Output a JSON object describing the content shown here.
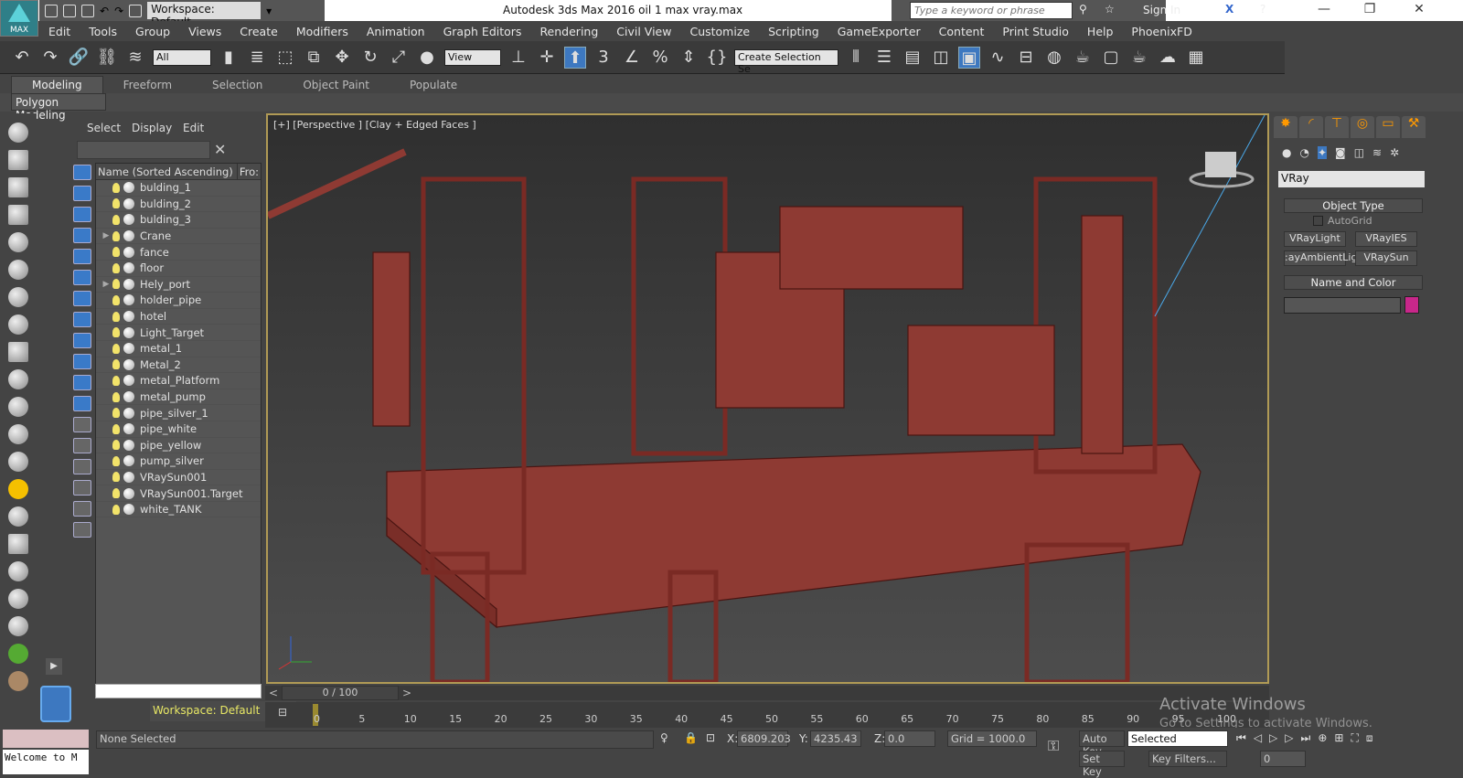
{
  "app": {
    "title": "Autodesk 3ds Max 2016    oil 1 max vray.max",
    "logo_text": "MAX",
    "workspace": "Workspace: Default"
  },
  "search": {
    "placeholder": "Type a keyword or phrase",
    "sign_in": "Sign In"
  },
  "menu": [
    "Edit",
    "Tools",
    "Group",
    "Views",
    "Create",
    "Modifiers",
    "Animation",
    "Graph Editors",
    "Rendering",
    "Civil View",
    "Customize",
    "Scripting",
    "GameExporter",
    "Content",
    "Print Studio",
    "Help",
    "PhoenixFD"
  ],
  "toolbar": {
    "filter": "All",
    "ref_coord": "View",
    "selection_set": "Create Selection Se",
    "snap_label": "3"
  },
  "ribbon": {
    "tabs": [
      "Modeling",
      "Freeform",
      "Selection",
      "Object Paint",
      "Populate"
    ],
    "active": "Modeling",
    "panel": "Polygon Modeling"
  },
  "explorer": {
    "tabs": [
      "Select",
      "Display",
      "Edit"
    ],
    "col_name": "Name (Sorted Ascending)",
    "col_frozen": "Fro:",
    "items": [
      {
        "name": "bulding_1",
        "type": "geometry",
        "expandable": false
      },
      {
        "name": "bulding_2",
        "type": "geometry",
        "expandable": false
      },
      {
        "name": "bulding_3",
        "type": "geometry",
        "expandable": false
      },
      {
        "name": "Crane",
        "type": "group",
        "expandable": true
      },
      {
        "name": "fance",
        "type": "geometry",
        "expandable": false
      },
      {
        "name": "floor",
        "type": "geometry",
        "expandable": false
      },
      {
        "name": "Hely_port",
        "type": "group",
        "expandable": true
      },
      {
        "name": "holder_pipe",
        "type": "geometry",
        "expandable": false
      },
      {
        "name": "hotel",
        "type": "geometry",
        "expandable": false
      },
      {
        "name": "Light_Target",
        "type": "group",
        "expandable": false
      },
      {
        "name": "metal_1",
        "type": "geometry",
        "expandable": false
      },
      {
        "name": "Metal_2",
        "type": "geometry",
        "expandable": false
      },
      {
        "name": "metal_Platform",
        "type": "geometry",
        "expandable": false
      },
      {
        "name": "metal_pump",
        "type": "geometry",
        "expandable": false
      },
      {
        "name": "pipe_silver_1",
        "type": "geometry",
        "expandable": false
      },
      {
        "name": "pipe_white",
        "type": "geometry",
        "expandable": false
      },
      {
        "name": "pipe_yellow",
        "type": "geometry",
        "expandable": false
      },
      {
        "name": "pump_silver",
        "type": "geometry",
        "expandable": false
      },
      {
        "name": "VRaySun001",
        "type": "light",
        "expandable": false
      },
      {
        "name": "VRaySun001.Target",
        "type": "light",
        "expandable": false
      },
      {
        "name": "white_TANK",
        "type": "geometry",
        "expandable": false
      }
    ],
    "workspace": "Workspace: Default"
  },
  "viewport": {
    "label": "[+] [Perspective ] [Clay + Edged Faces ]",
    "model_color": "#8e3a33"
  },
  "command_panel": {
    "category": "VRay",
    "object_type": "Object Type",
    "autogrid": "AutoGrid",
    "buttons": [
      "VRayLight",
      "VRayIES",
      "VRayAmbientLight",
      "VRaySun"
    ],
    "buttons_display": [
      "VRayLight",
      "VRayIES",
      ":ayAmbientLig",
      "VRaySun"
    ],
    "name_color": "Name and Color",
    "swatch": "#c8278a"
  },
  "timeline": {
    "frame": "0 / 100",
    "ticks": [
      "0",
      "5",
      "10",
      "15",
      "20",
      "25",
      "30",
      "35",
      "40",
      "45",
      "50",
      "55",
      "60",
      "65",
      "70",
      "75",
      "80",
      "85",
      "90",
      "95",
      "100"
    ],
    "progress": 0
  },
  "status": {
    "selection": "None Selected",
    "x_label": "X:",
    "x": "6809.203",
    "y_label": "Y:",
    "y": "4235.43",
    "z_label": "Z:",
    "z": "0.0",
    "grid": "Grid = 1000.0",
    "auto_key": "Auto Key",
    "set_key": "Set Key",
    "key_mode": "Selected",
    "key_filters": "Key Filters...",
    "frame_field": "0",
    "listener": "Welcome to M"
  },
  "watermark": {
    "line1": "Activate Windows",
    "line2": "Go to Settings to activate Windows."
  }
}
